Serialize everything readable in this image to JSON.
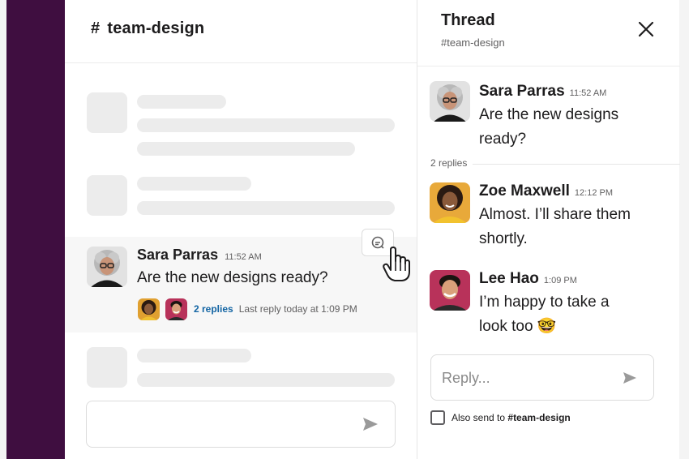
{
  "channel": {
    "hash": "#",
    "name": "team-design",
    "message": {
      "author": "Sara Parras",
      "time": "11:52 AM",
      "text": "Are the new designs ready?",
      "replies_link": "2 replies",
      "replies_meta": "Last reply today at 1:09 PM"
    }
  },
  "thread": {
    "title": "Thread",
    "subtitle": "#team-design",
    "parent": {
      "author": "Sara Parras",
      "time": "11:52 AM",
      "text": "Are the new designs ready?"
    },
    "replies_count": "2 replies",
    "replies": [
      {
        "author": "Zoe Maxwell",
        "time": "12:12 PM",
        "text": "Almost. I’ll share them shortly."
      },
      {
        "author": "Lee Hao",
        "time": "1:09 PM",
        "text": "I’m happy to take a look too 🤓"
      }
    ],
    "reply_placeholder": "Reply...",
    "also_send_prefix": "Also send to",
    "also_send_channel": "#team-design"
  },
  "icons": {
    "close": "close-icon",
    "send": "send-icon",
    "reply_in_thread": "speech-bubble-icon",
    "cursor": "hand-pointer-icon"
  },
  "colors": {
    "sidebar": "#3f0e40",
    "link": "#1264a3",
    "skeleton": "#ececec"
  }
}
